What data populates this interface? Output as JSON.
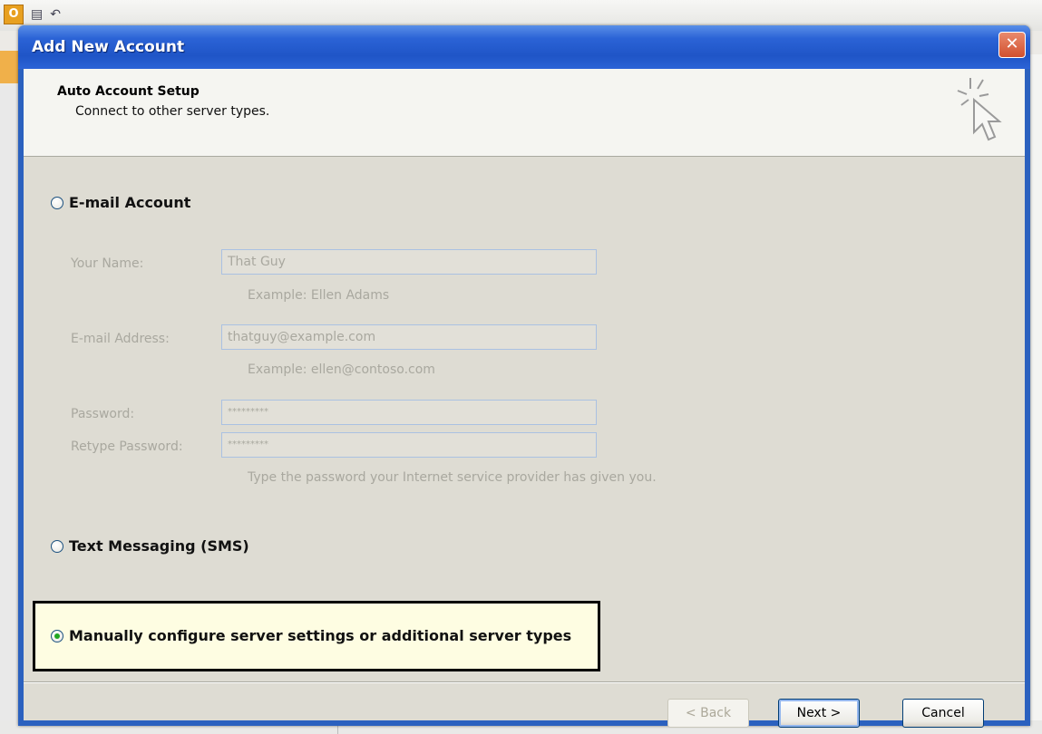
{
  "window": {
    "title": "Add New Account",
    "close_glyph": "✕"
  },
  "header": {
    "title": "Auto Account Setup",
    "subtitle": "Connect to other server types.",
    "icon": "wizard-cursor-sparkle-icon"
  },
  "options": {
    "email_account": {
      "label": "E-mail Account",
      "selected": false
    },
    "sms": {
      "label": "Text Messaging (SMS)",
      "selected": false
    },
    "manual": {
      "label": "Manually configure server settings or additional server types",
      "selected": true
    }
  },
  "form": {
    "your_name": {
      "label": "Your Name:",
      "value": "That Guy",
      "hint": "Example: Ellen Adams"
    },
    "email": {
      "label": "E-mail Address:",
      "value": "thatguy@example.com",
      "hint": "Example: ellen@contoso.com"
    },
    "password": {
      "label": "Password:",
      "value": "*********"
    },
    "retype_password": {
      "label": "Retype Password:",
      "value": "*********"
    },
    "password_hint": "Type the password your Internet service provider has given you."
  },
  "buttons": {
    "back": "< Back",
    "next": "Next >",
    "cancel": "Cancel"
  },
  "colors": {
    "titlebar": "#2b63d6",
    "highlight_bg": "#fefde2",
    "dialog_bg": "#dedcd3"
  }
}
